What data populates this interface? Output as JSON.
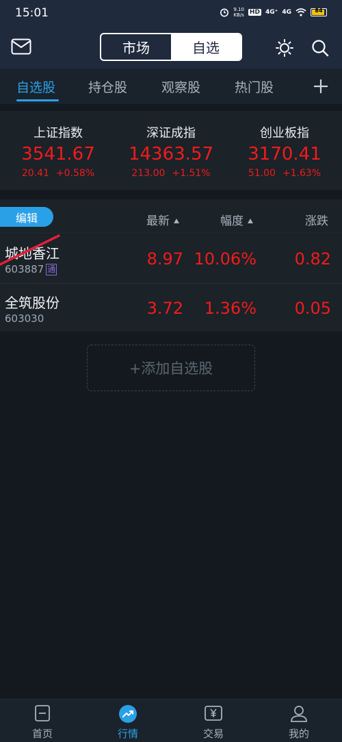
{
  "status_bar": {
    "time": "15:01",
    "net_speed_value": "9.10",
    "net_speed_unit": "KB/s",
    "hd_label": "HD",
    "network_1": "4G⁺",
    "network_2": "4G",
    "battery": "84"
  },
  "header": {
    "segment_market": "市场",
    "segment_watchlist": "自选",
    "active_segment": "自选"
  },
  "tabs": [
    {
      "label": "自选股",
      "active": true
    },
    {
      "label": "持仓股",
      "active": false
    },
    {
      "label": "观察股",
      "active": false
    },
    {
      "label": "热门股",
      "active": false
    }
  ],
  "indexes": [
    {
      "name": "上证指数",
      "value": "3541.67",
      "change": "20.41",
      "percent": "+0.58%"
    },
    {
      "name": "深证成指",
      "value": "14363.57",
      "change": "213.00",
      "percent": "+1.51%"
    },
    {
      "name": "创业板指",
      "value": "3170.41",
      "change": "51.00",
      "percent": "+1.63%"
    }
  ],
  "list_header": {
    "edit": "编辑",
    "latest": "最新",
    "range": "幅度",
    "change": "涨跌"
  },
  "stocks": [
    {
      "name": "城地香江",
      "code": "603887",
      "badge": "通",
      "latest": "8.97",
      "range": "10.06%",
      "change": "0.82"
    },
    {
      "name": "全筑股份",
      "code": "603030",
      "badge": "",
      "latest": "3.72",
      "range": "1.36%",
      "change": "0.05"
    }
  ],
  "add_button": "+添加自选股",
  "bottom_nav": [
    {
      "label": "首页",
      "icon": "home-icon",
      "active": false
    },
    {
      "label": "行情",
      "icon": "market-trend-icon",
      "active": true
    },
    {
      "label": "交易",
      "icon": "trade-yen-icon",
      "active": false
    },
    {
      "label": "我的",
      "icon": "profile-icon",
      "active": false
    }
  ],
  "colors": {
    "accent": "#2aa1e6",
    "up": "#f21b1b",
    "header_bg": "#1f2a3d",
    "page_bg": "#13191f"
  }
}
